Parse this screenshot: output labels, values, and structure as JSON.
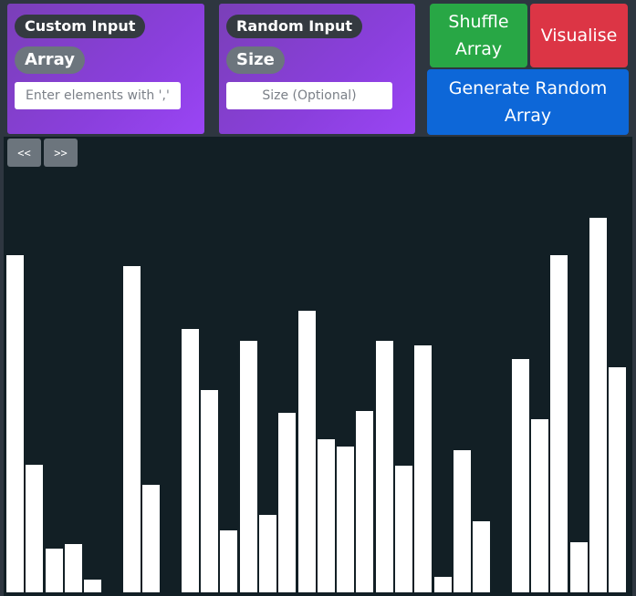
{
  "custom_input": {
    "title": "Custom Input",
    "label": "Array",
    "placeholder": "Enter elements with ','"
  },
  "random_input": {
    "title": "Random Input",
    "label": "Size",
    "placeholder": "Size (Optional)"
  },
  "buttons": {
    "shuffle": "Shuffle Array",
    "visualise": "Visualise",
    "generate": "Generate Random Array"
  },
  "nav": {
    "prev": "<<",
    "next": ">>"
  },
  "colors": {
    "bar": "#ffffff",
    "background": "#121f25",
    "shuffle": "#28a745",
    "visualise": "#dc3545",
    "generate": "#0d67d8"
  },
  "chart_data": {
    "type": "bar",
    "values": [
      370,
      140,
      48,
      53,
      14,
      0,
      358,
      118,
      0,
      289,
      222,
      68,
      276,
      85,
      197,
      309,
      168,
      160,
      199,
      276,
      139,
      271,
      17,
      156,
      78,
      0,
      256,
      190,
      370,
      55,
      411,
      247
    ]
  }
}
